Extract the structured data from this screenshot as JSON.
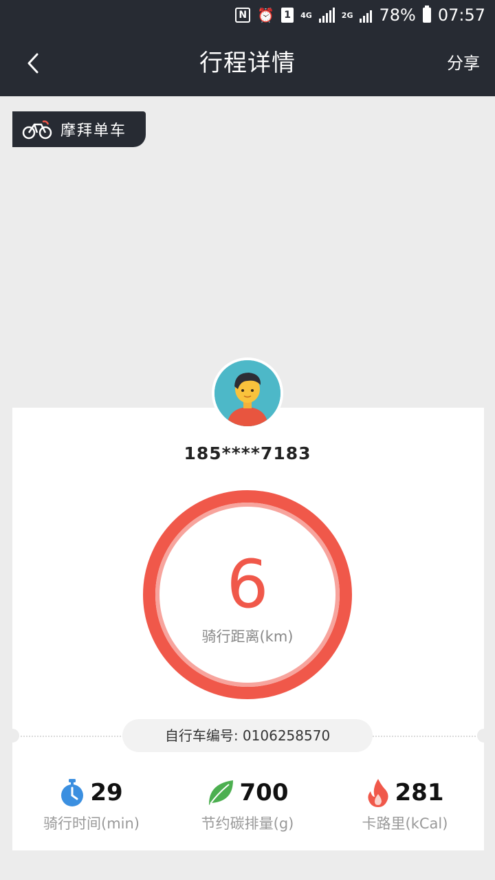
{
  "status_bar": {
    "battery": "78%",
    "time": "07:57",
    "sim_slot": "1",
    "net_4g": "4G",
    "net_2g": "2G"
  },
  "header": {
    "title": "行程详情",
    "share_label": "分享"
  },
  "brand": {
    "name": "摩拜单车"
  },
  "rider": {
    "phone": "185****7183"
  },
  "distance": {
    "value": "6",
    "label": "骑行距离(km)"
  },
  "bike": {
    "id_text": "自行车编号: 0106258570"
  },
  "stats": [
    {
      "icon": "stopwatch-icon",
      "value": "29",
      "label": "骑行时间(min)",
      "color": "#3b8fe0"
    },
    {
      "icon": "leaf-icon",
      "value": "700",
      "label": "节约碳排量(g)",
      "color": "#4caf50"
    },
    {
      "icon": "flame-icon",
      "value": "281",
      "label": "卡路里(kCal)",
      "color": "#f0584a"
    }
  ],
  "colors": {
    "accent": "#f0584a",
    "nav_bg": "#272b33",
    "page_bg": "#ececec"
  }
}
